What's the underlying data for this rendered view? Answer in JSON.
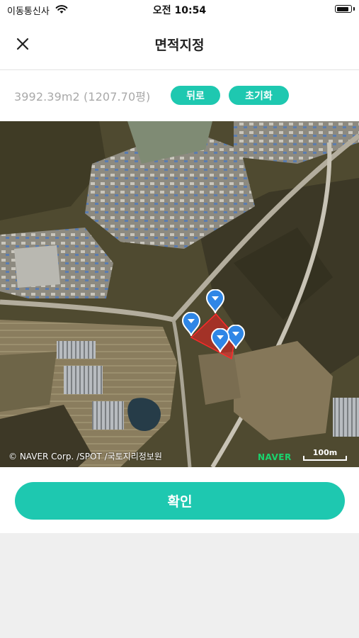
{
  "status_bar": {
    "carrier": "이동통신사",
    "time": "오전 10:54",
    "wifi_icon": "wifi-icon",
    "battery_icon": "battery-icon",
    "battery_level": 0.9
  },
  "header": {
    "title": "면적지정",
    "close_icon": "close-icon"
  },
  "area": {
    "value_text": "3992.39m2 (1207.70평)",
    "back_label": "뒤로",
    "reset_label": "초기화"
  },
  "map": {
    "attribution": "© NAVER Corp. /SPOT /국토지리정보원",
    "logo": "NAVER",
    "scale_label": "100m",
    "marker_icon": "map-pin-icon",
    "marker_count": 4,
    "polygon_color": "#e02020"
  },
  "confirm": {
    "label": "확인"
  },
  "colors": {
    "accent": "#1ec8b0",
    "muted_text": "#a9a9a9",
    "background": "#efefef"
  }
}
